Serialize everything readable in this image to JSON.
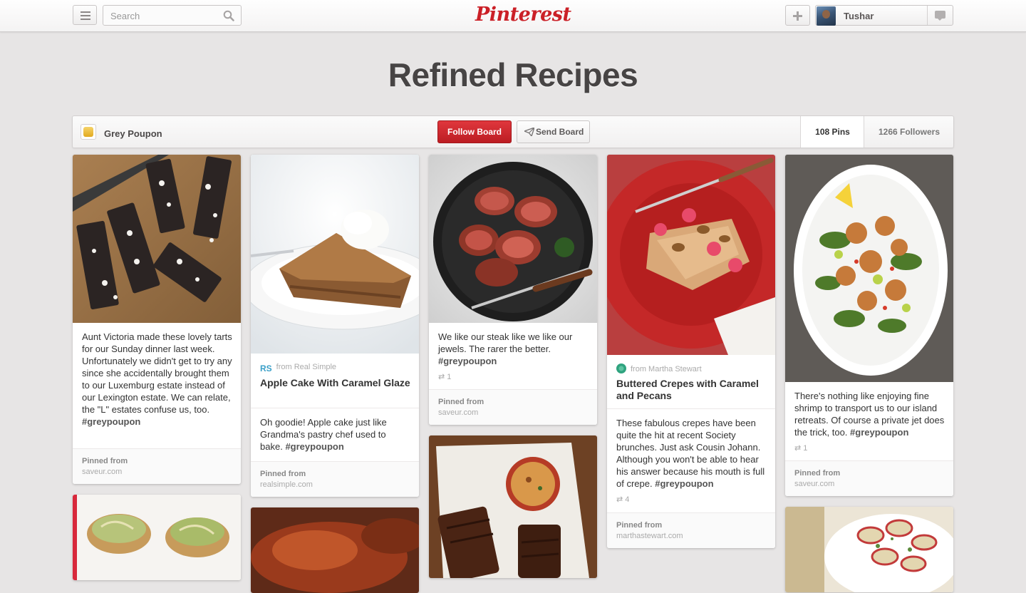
{
  "header": {
    "search_placeholder": "Search",
    "logo_text": "Pinterest",
    "user_name": "Tushar",
    "brand_color": "#cb2027"
  },
  "board": {
    "title": "Refined Recipes",
    "owner": "Grey Poupon",
    "follow_label": "Follow Board",
    "send_label": "Send Board",
    "pins_count": "108 Pins",
    "followers_count": "1266 Followers"
  },
  "pins": [
    {
      "description": "Aunt Victoria made these lovely tarts for our Sunday dinner last week. Unfortunately we didn't get to try any since she accidentally brought them to our Luxemburg estate instead of our Lexington estate. We can relate, the \"L\" estates confuse us, too.",
      "hashtag": "#greypoupon",
      "pinned_from": "Pinned from",
      "domain": "saveur.com"
    },
    {
      "source": "from Real Simple",
      "source_badge": "RS",
      "title": "Apple Cake With Caramel Glaze",
      "description": "Oh goodie! Apple cake just like Grandma's pastry chef used to bake.",
      "hashtag": "#greypoupon",
      "pinned_from": "Pinned from",
      "domain": "realsimple.com"
    },
    {
      "description": "We like our steak like we like our jewels. The rarer the better.",
      "hashtag": "#greypoupon",
      "repins": "1",
      "pinned_from": "Pinned from",
      "domain": "saveur.com"
    },
    {
      "source": "from Martha Stewart",
      "title": "Buttered Crepes with Caramel and Pecans",
      "description": "These fabulous crepes have been quite the hit at recent Society brunches. Just ask Cousin Johann. Although you won't be able to hear his answer because his mouth is full of crepe.",
      "hashtag": "#greypoupon",
      "repins": "4",
      "pinned_from": "Pinned from",
      "domain": "marthastewart.com"
    },
    {
      "description": "There's nothing like enjoying fine shrimp to transport us to our island retreats. Of course a private jet does the trick, too.",
      "hashtag": "#greypoupon",
      "repins": "1",
      "pinned_from": "Pinned from",
      "domain": "saveur.com"
    }
  ]
}
